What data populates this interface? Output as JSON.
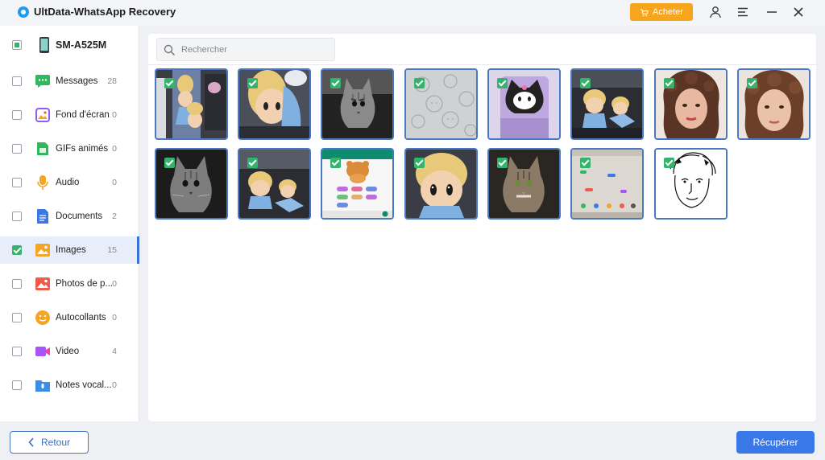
{
  "app": {
    "title": "UltData-WhatsApp Recovery",
    "buy_label": "Acheter",
    "accent": "#3a78e8",
    "buy_color": "#f7a51d"
  },
  "sidebar": {
    "device": {
      "label": "SM-A525M",
      "icon": "phone-icon"
    },
    "items": [
      {
        "label": "Messages",
        "count": "28",
        "icon": "chat-bubble-icon",
        "color": "#2fb85c",
        "checked": false
      },
      {
        "label": "Fond d'écran",
        "count": "0",
        "icon": "wallpaper-icon",
        "color": "#8b5cf6",
        "checked": false
      },
      {
        "label": "GIFs animés",
        "count": "0",
        "icon": "gif-icon",
        "color": "#2fb85c",
        "checked": false
      },
      {
        "label": "Audio",
        "count": "0",
        "icon": "microphone-icon",
        "color": "#f5a524",
        "checked": false
      },
      {
        "label": "Documents",
        "count": "2",
        "icon": "document-icon",
        "color": "#3a78e8",
        "checked": false
      },
      {
        "label": "Images",
        "count": "15",
        "icon": "image-icon",
        "color": "#f5a524",
        "checked": true
      },
      {
        "label": "Photos de p...",
        "count": "0",
        "icon": "photo-icon",
        "color": "#ef5a4a",
        "checked": false
      },
      {
        "label": "Autocollants",
        "count": "0",
        "icon": "sticker-icon",
        "color": "#f5a524",
        "checked": false
      },
      {
        "label": "Video",
        "count": "4",
        "icon": "video-icon",
        "color": "#a855f7",
        "checked": false
      },
      {
        "label": "Notes vocal...",
        "count": "0",
        "icon": "voice-note-icon",
        "color": "#3a8ee8",
        "checked": false
      }
    ]
  },
  "search": {
    "placeholder": "Rechercher",
    "value": ""
  },
  "images": [
    {
      "name": "dolls-on-fridge",
      "checked": true
    },
    {
      "name": "doll-closeup-blue",
      "checked": true
    },
    {
      "name": "cat-bw-1",
      "checked": true
    },
    {
      "name": "pattern-fabric",
      "checked": true
    },
    {
      "name": "kuromi-cup",
      "checked": true
    },
    {
      "name": "dolls-desk-1",
      "checked": true
    },
    {
      "name": "woman-curly-hair-1",
      "checked": true
    },
    {
      "name": "woman-curly-hair-2",
      "checked": true
    },
    {
      "name": "cat-bw-2",
      "checked": true
    },
    {
      "name": "dolls-desk-2",
      "checked": true
    },
    {
      "name": "whatsapp-sticker-screenshot",
      "checked": true
    },
    {
      "name": "doll-head-blonde",
      "checked": true
    },
    {
      "name": "cat-color",
      "checked": true
    },
    {
      "name": "phone-screenshot",
      "checked": true
    },
    {
      "name": "face-sketch",
      "checked": true
    }
  ],
  "footer": {
    "back_label": "Retour",
    "recover_label": "Récupérer"
  }
}
